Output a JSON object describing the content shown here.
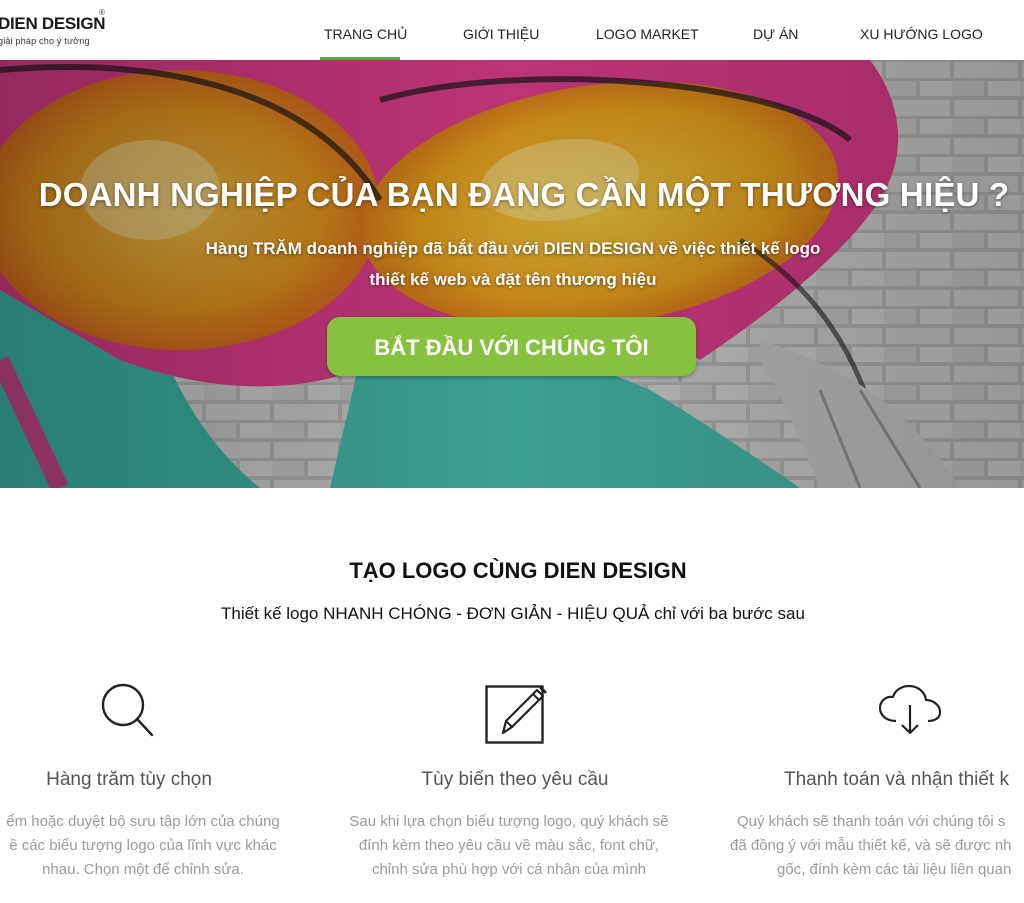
{
  "brand": {
    "name": "DIEN DESIGN",
    "registered": "®",
    "tagline": "giải pháp cho ý tưởng"
  },
  "nav": {
    "items": [
      {
        "label": "TRANG CHỦ",
        "active": true
      },
      {
        "label": "GIỚI THIỆU"
      },
      {
        "label": "LOGO MARKET"
      },
      {
        "label": "DỰ ÁN"
      },
      {
        "label": "XU HƯỚNG LOGO"
      }
    ],
    "accent_color": "#5aa73c"
  },
  "hero": {
    "title": "DOANH NGHIỆP CỦA BẠN ĐANG CẦN MỘT THƯƠNG HIỆU ?",
    "subtitle_lines": [
      "Hàng TRĂM doanh nghiệp đã bắt đầu với DIEN DESIGN về việc thiết kế logo",
      "thiết kế web và đặt tên thương hiệu"
    ],
    "cta_label": "BẮT ĐẦU VỚI CHÚNG TÔI",
    "cta_color": "#86c13f"
  },
  "section": {
    "title": "TẠO LOGO CÙNG DIEN DESIGN",
    "subtitle": "Thiết kế logo NHANH CHÓNG - ĐƠN GIẢN - HIỆU QUẢ chỉ với ba bước sau"
  },
  "features": [
    {
      "icon": "search-icon",
      "title": "Hàng trăm tùy chọn",
      "desc_lines": [
        "ểm hoặc duyệt bộ sưu tập lớn của chúng",
        "ề các biểu tượng logo của lĩnh vực khác",
        "nhau. Chọn một để chỉnh sửa."
      ]
    },
    {
      "icon": "edit-icon",
      "title": "Tùy biến theo yêu cầu",
      "desc_lines": [
        "Sau khi lựa chọn biểu tượng logo, quý khách sẽ",
        "đính kèm theo yêu cầu về màu sắc, font chữ,",
        "chỉnh sửa phù hợp với cá nhân của mình"
      ]
    },
    {
      "icon": "cloud-download-icon",
      "title": "Thanh toán và nhận thiết k",
      "desc_lines": [
        "Quý khách sẽ thanh toán với chúng tôi s",
        "đã đồng ý với mẫu thiết kế, và sẽ được nh",
        "gốc, đính kèm các tài liệu liên quan"
      ]
    }
  ]
}
